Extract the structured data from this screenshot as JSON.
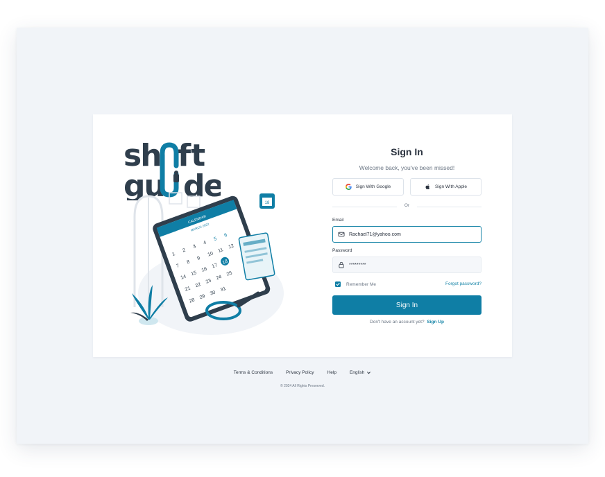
{
  "brand": {
    "logo_text": "shaftguide",
    "primary_color": "#0f7ea5",
    "dark_color": "#2f3e4c"
  },
  "illustration": {
    "calendar_title": "CALENDAR",
    "calendar_month": "MARCH 2022",
    "date_badge": "18"
  },
  "signin": {
    "title": "Sign In",
    "subtitle": "Welcome back, you've been missed!",
    "google_label": "Sign With Google",
    "apple_label": "Sign With Apple",
    "divider_text": "Or",
    "email_label": "Email",
    "email_value": "Rachael71@yahoo.com",
    "password_label": "Password",
    "password_value": "*********",
    "remember_label": "Remember Me",
    "remember_checked": true,
    "forgot_label": "Forgot password?",
    "submit_label": "Sign In",
    "signup_prompt": "Don't have an account yet?",
    "signup_link": "Sign Up"
  },
  "footer": {
    "links": [
      "Terms & Conditions",
      "Privacy Policy",
      "Help"
    ],
    "language": "English",
    "copyright": "© 2024 All Rights Preserved."
  }
}
